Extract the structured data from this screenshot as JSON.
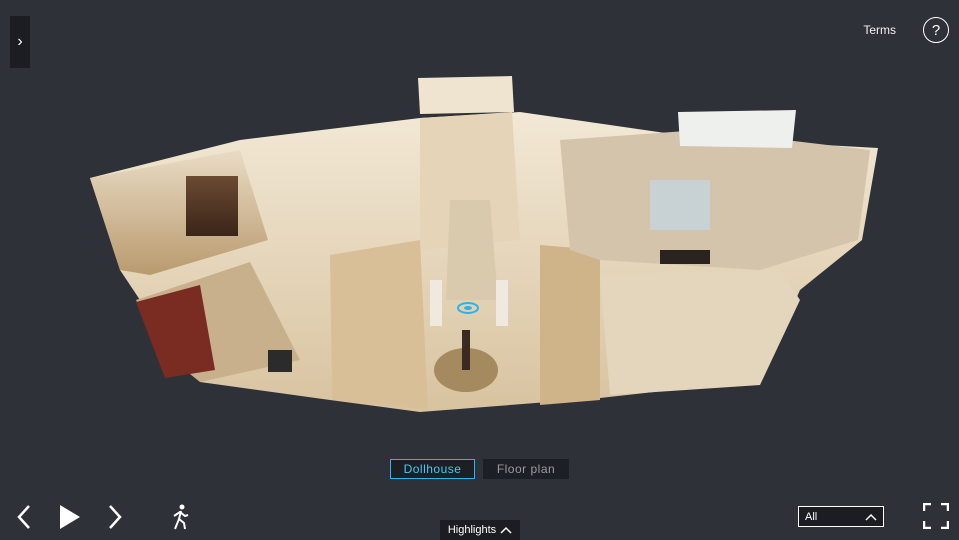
{
  "header": {
    "terms_label": "Terms",
    "help_symbol": "?"
  },
  "sidebar": {
    "toggle_symbol": "›"
  },
  "modes": {
    "dollhouse_label": "Dollhouse",
    "floorplan_label": "Floor plan"
  },
  "highlights": {
    "label": "Highlights"
  },
  "floor_select": {
    "value": "All"
  },
  "icons": {
    "sidebar": "chevron-right-icon",
    "help": "help-icon",
    "prev": "chevron-left-icon",
    "play": "play-icon",
    "next": "chevron-right-icon",
    "walk": "walking-person-icon",
    "highlights": "chevron-up-icon",
    "floor": "chevron-up-icon",
    "fullscreen": "fullscreen-icon"
  },
  "colors": {
    "background": "#2e3138",
    "accent": "#29b6e6",
    "panel": "#1b1d22"
  }
}
